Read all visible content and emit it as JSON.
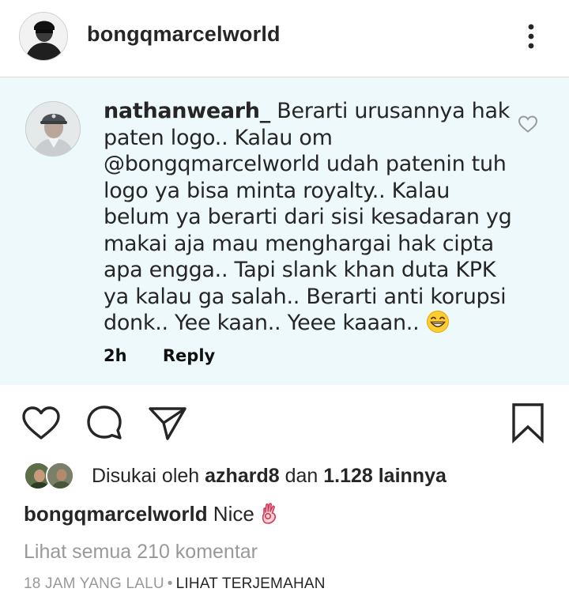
{
  "post": {
    "username": "bongqmarcelworld"
  },
  "comment": {
    "username": "nathanwearh_",
    "text": " Berarti urusannya hak paten logo.. Kalau om @bongqmarcelworld udah patenin tuh logo ya bisa minta royalty.. Kalau belum ya berarti dari sisi kesadaran yg makai aja mau menghargai hak cipta apa engga.. Tapi slank khan duta KPK ya kalau ga salah.. Berarti anti korupsi donk.. Yee kaan.. Yeee kaaan.. ",
    "time": "2h",
    "reply_label": "Reply"
  },
  "likes": {
    "prefix": "Disukai oleh ",
    "user": "azhard8",
    "middle": " dan ",
    "count": "1.128 lainnya"
  },
  "caption": {
    "username": "bongqmarcelworld",
    "text": " Nice"
  },
  "view_all_comments": "Lihat semua 210 komentar",
  "footer": {
    "time_ago": "18 JAM YANG LALU",
    "separator": "•",
    "translate": "LIHAT TERJEMAHAN"
  },
  "icons": {
    "more": "more-vertical-icon",
    "like": "heart-icon",
    "comment": "comment-bubble-icon",
    "share": "paper-plane-icon",
    "save": "bookmark-icon"
  },
  "colors": {
    "text": "#262626",
    "muted": "#999999",
    "comment_bg": "#eef9fb",
    "divider": "#dbdbdb"
  }
}
